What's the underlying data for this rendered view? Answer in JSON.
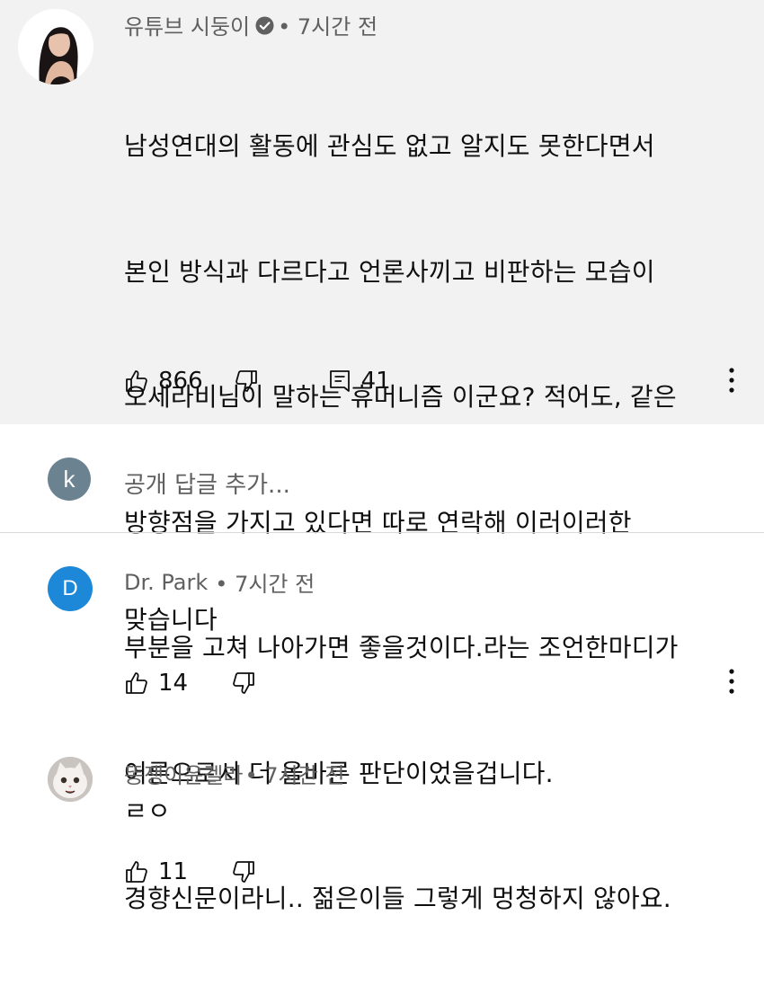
{
  "top_comment": {
    "author": "유튜브 시둥이",
    "time": "• 7시간 전",
    "lines": [
      "남성연대의 활동에 관심도 없고 알지도 못한다면서",
      "본인 방식과 다르다고 언론사끼고 비판하는 모습이",
      "오세라비님이 말하는 휴머니즘 이군요? 적어도, 같은",
      "방향점을 가지고 있다면 따로 연락해 이러이러한",
      "부분을 고쳐 나아가면 좋을것이다.라는 조언한마디가",
      "어른으로서 더 올바른 판단이었을겁니다.",
      "경향신문이라니.. 젊은이들 그렇게 멍청하지 않아요."
    ],
    "likes": "866",
    "replies": "41"
  },
  "reply_input": {
    "avatar_letter": "k",
    "placeholder": "공개 답글 추가..."
  },
  "replies": [
    {
      "author": "Dr. Park",
      "time": "• 7시간 전",
      "avatar_letter": "D",
      "avatar_color": "#1e88d8",
      "text": "맞습니다",
      "likes": "14"
    },
    {
      "author": "똥쟁이윤겔라",
      "time": "• 7시간 전",
      "text": "ㄹㅇ",
      "likes": "11"
    }
  ],
  "colors": {
    "highlight_bg": "#f2f2f2",
    "meta_text": "#606060",
    "k_avatar": "#6b8290"
  }
}
